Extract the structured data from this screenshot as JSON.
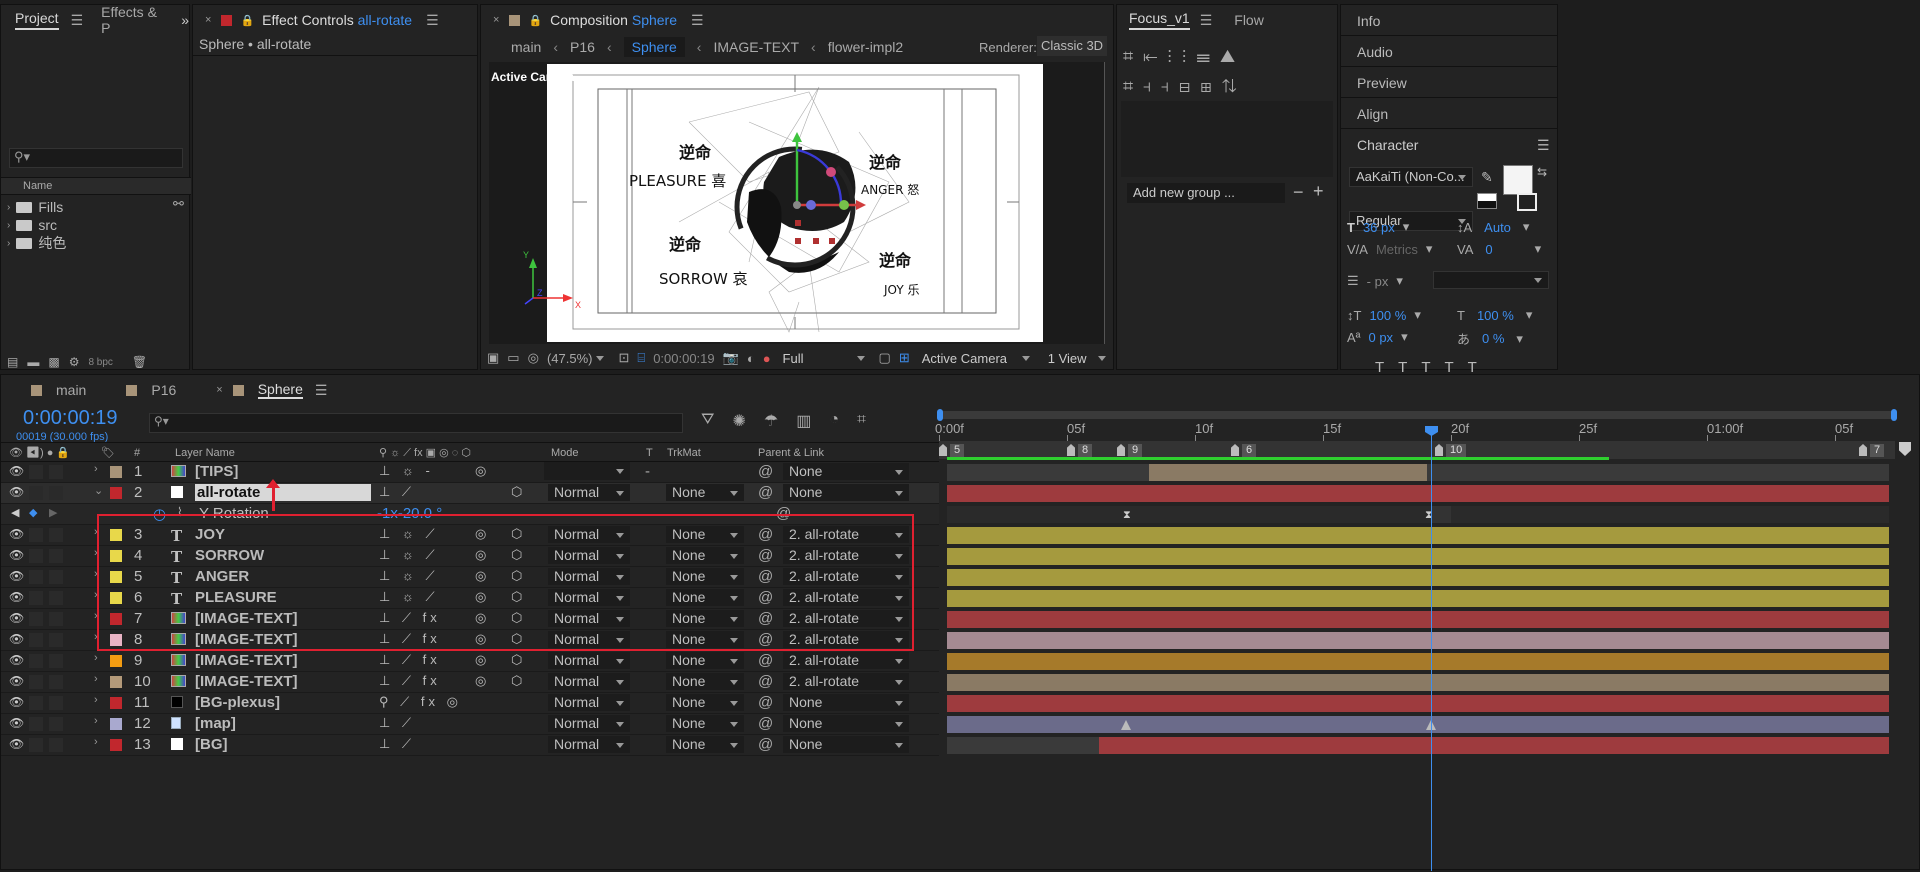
{
  "project_panel": {
    "tab_project": "Project",
    "tab_effects": "Effects & P",
    "col_name": "Name",
    "items": [
      "Fills",
      "src",
      "纯色"
    ],
    "bpc": "8 bpc"
  },
  "effect_controls": {
    "title": "Effect Controls",
    "layer": "all-rotate",
    "breadcrumb": "Sphere • all-rotate"
  },
  "composition": {
    "title": "Composition",
    "name": "Sphere",
    "crumbs": [
      "main",
      "P16",
      "Sphere",
      "IMAGE-TEXT",
      "flower-impl2"
    ],
    "renderer_label": "Renderer:",
    "renderer": "Classic 3D",
    "camera_overlay": "Active Camera",
    "zoom": "(47.5%)",
    "timecode": "0:00:00:19",
    "resolution": "Full",
    "view_camera": "Active Camera",
    "view_count": "1 View",
    "artwork": {
      "pleasure": "PLEASURE 喜",
      "anger": "ANGER 怒",
      "sorrow": "SORROW 哀",
      "joy": "JOY 乐",
      "nimin": "逆命"
    }
  },
  "focus_panel": {
    "tab": "Focus_v1",
    "tab2": "Flow",
    "add_group": "Add new group ..."
  },
  "right_panels": {
    "info": "Info",
    "audio": "Audio",
    "preview": "Preview",
    "align": "Align",
    "character": "Character",
    "font": "AaKaiTi (Non-Co...",
    "style": "Regular",
    "size": "36 px",
    "leading": "Auto",
    "kerning": "Metrics",
    "tracking": "0",
    "stroke": "- px",
    "vscale": "100 %",
    "hscale": "100 %",
    "baseline": "0 px",
    "tsume": "0 %"
  },
  "timeline": {
    "tabs": [
      "main",
      "P16",
      "Sphere"
    ],
    "timecode": "0:00:00:19",
    "frames": "00019 (30.000 fps)",
    "col_layer_name": "Layer Name",
    "col_mode": "Mode",
    "col_t": "T",
    "col_trkmat": "TrkMat",
    "col_parent": "Parent & Link",
    "col_num": "#",
    "ruler": [
      "0:00f",
      "05f",
      "10f",
      "15f",
      "20f",
      "25f",
      "01:00f",
      "05f"
    ],
    "markers": [
      "5",
      "8",
      "9",
      "6",
      "10",
      "7"
    ],
    "property": {
      "name": "Y Rotation",
      "value": "-1x-20.0 °"
    },
    "layers": [
      {
        "num": "1",
        "name": "[TIPS]",
        "type": "img",
        "label": "#a89479",
        "mode": "-",
        "trk": "",
        "parent": "None"
      },
      {
        "num": "2",
        "name": "all-rotate",
        "type": "solid",
        "label": "#c1272d",
        "mode": "Normal",
        "trk": "None",
        "parent": "None"
      },
      {
        "num": "3",
        "name": "JOY",
        "type": "text",
        "label": "#e8d84a",
        "mode": "Normal",
        "trk": "None",
        "parent": "2. all-rotate"
      },
      {
        "num": "4",
        "name": "SORROW",
        "type": "text",
        "label": "#e8d84a",
        "mode": "Normal",
        "trk": "None",
        "parent": "2. all-rotate"
      },
      {
        "num": "5",
        "name": "ANGER",
        "type": "text",
        "label": "#e8d84a",
        "mode": "Normal",
        "trk": "None",
        "parent": "2. all-rotate"
      },
      {
        "num": "6",
        "name": "PLEASURE",
        "type": "text",
        "label": "#e8d84a",
        "mode": "Normal",
        "trk": "None",
        "parent": "2. all-rotate"
      },
      {
        "num": "7",
        "name": "[IMAGE-TEXT]",
        "type": "img",
        "label": "#c1272d",
        "mode": "Normal",
        "trk": "None",
        "parent": "2. all-rotate"
      },
      {
        "num": "8",
        "name": "[IMAGE-TEXT]",
        "type": "img",
        "label": "#e9b3c4",
        "mode": "Normal",
        "trk": "None",
        "parent": "2. all-rotate"
      },
      {
        "num": "9",
        "name": "[IMAGE-TEXT]",
        "type": "img",
        "label": "#f39c12",
        "mode": "Normal",
        "trk": "None",
        "parent": "2. all-rotate"
      },
      {
        "num": "10",
        "name": "[IMAGE-TEXT]",
        "type": "img",
        "label": "#b49a7a",
        "mode": "Normal",
        "trk": "None",
        "parent": "2. all-rotate"
      },
      {
        "num": "11",
        "name": "[BG-plexus]",
        "type": "solid-black",
        "label": "#c1272d",
        "mode": "Normal",
        "trk": "None",
        "parent": "None"
      },
      {
        "num": "12",
        "name": "[map]",
        "type": "file",
        "label": "#a9a9cf",
        "mode": "Normal",
        "trk": "None",
        "parent": "None"
      },
      {
        "num": "13",
        "name": "[BG]",
        "type": "solid",
        "label": "#c1272d",
        "mode": "Normal",
        "trk": "None",
        "parent": "None"
      }
    ]
  },
  "colors": {
    "accent_blue": "#3e8ff0",
    "selection_red": "#e02030",
    "bar_red": "#9e3b3e",
    "bar_yellow": "#a59a3e",
    "bar_pink": "#a58a92",
    "bar_orange": "#a67a2a",
    "bar_tan": "#8a7a64",
    "bar_lavender": "#6b6b8a"
  }
}
